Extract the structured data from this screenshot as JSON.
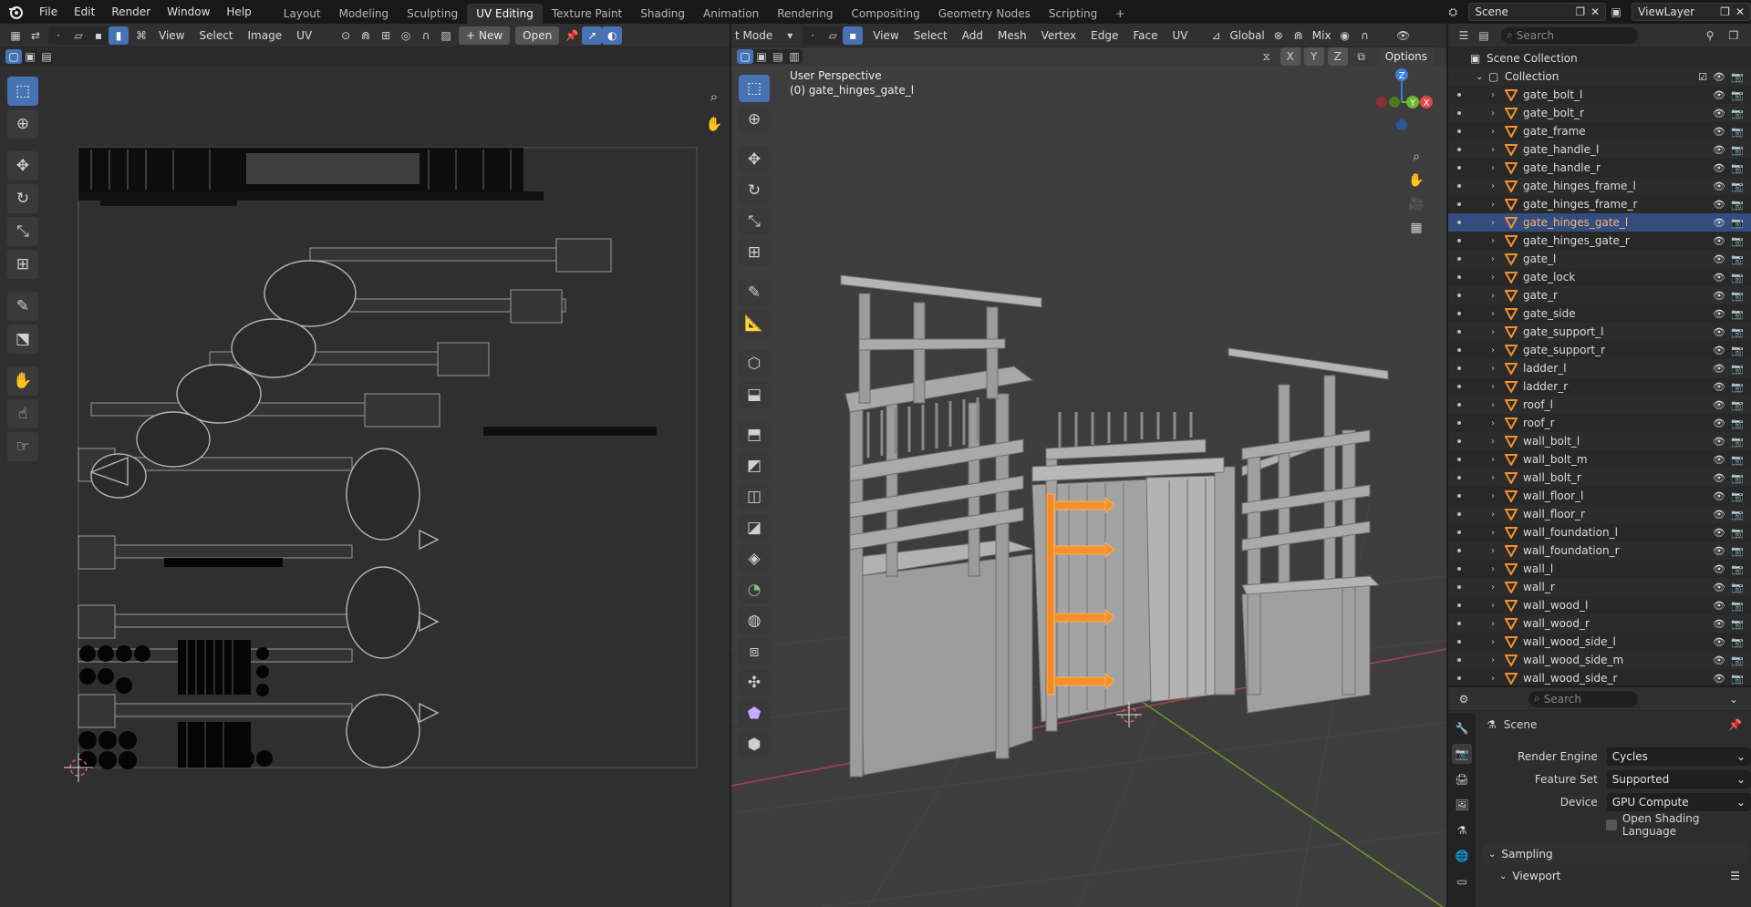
{
  "menu": {
    "items": [
      "File",
      "Edit",
      "Render",
      "Window",
      "Help"
    ]
  },
  "workspaces": {
    "tabs": [
      "Layout",
      "Modeling",
      "Sculpting",
      "UV Editing",
      "Texture Paint",
      "Shading",
      "Animation",
      "Rendering",
      "Compositing",
      "Geometry Nodes",
      "Scripting"
    ],
    "active": "UV Editing",
    "add_symbol": "+"
  },
  "topright": {
    "scene": "Scene",
    "viewlayer": "ViewLayer"
  },
  "uv_editor": {
    "menus": [
      "View",
      "Select",
      "Image",
      "UV"
    ],
    "new_label": "+ New",
    "open_label": "Open"
  },
  "viewport": {
    "mode": "t Mode",
    "menus": [
      "View",
      "Select",
      "Add",
      "Mesh",
      "Vertex",
      "Edge",
      "Face",
      "UV"
    ],
    "transform": "Global",
    "snap": "Mix",
    "options": "Options",
    "axis_x": "X",
    "axis_y": "Y",
    "axis_z": "Z",
    "perspective": "User Perspective",
    "active_object": "(0) gate_hinges_gate_l",
    "gizmo": {
      "x": "X",
      "y": "Y",
      "z": "Z"
    }
  },
  "outliner": {
    "search_placeholder": "Search",
    "scene_collection": "Scene Collection",
    "collection": "Collection",
    "objects": [
      "gate_bolt_l",
      "gate_bolt_r",
      "gate_frame",
      "gate_handle_l",
      "gate_handle_r",
      "gate_hinges_frame_l",
      "gate_hinges_frame_r",
      "gate_hinges_gate_l",
      "gate_hinges_gate_r",
      "gate_l",
      "gate_lock",
      "gate_r",
      "gate_side",
      "gate_support_l",
      "gate_support_r",
      "ladder_l",
      "ladder_r",
      "roof_l",
      "roof_r",
      "wall_bolt_l",
      "wall_bolt_m",
      "wall_bolt_r",
      "wall_floor_l",
      "wall_floor_r",
      "wall_foundation_l",
      "wall_foundation_r",
      "wall_l",
      "wall_r",
      "wall_wood_l",
      "wall_wood_r",
      "wall_wood_side_l",
      "wall_wood_side_m",
      "wall_wood_side_r"
    ],
    "selected": "gate_hinges_gate_l"
  },
  "properties": {
    "search_placeholder": "Search",
    "context": "Scene",
    "render_engine_label": "Render Engine",
    "render_engine": "Cycles",
    "feature_set_label": "Feature Set",
    "feature_set": "Supported",
    "device_label": "Device",
    "device": "GPU Compute",
    "osl_label": "Open Shading Language",
    "sampling": "Sampling",
    "viewport_panel": "Viewport"
  },
  "colors": {
    "accent": "#4772b3",
    "selected_object": "#f5902b",
    "axis_red": "#e0464e",
    "axis_green": "#6bb82d",
    "axis_blue": "#3e7bd6"
  }
}
